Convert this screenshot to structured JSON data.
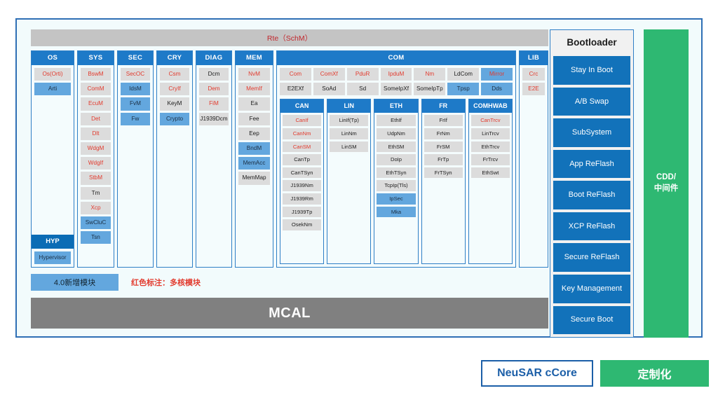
{
  "frame": {
    "rte_bar_label": "Rte（SchM）",
    "mcal_label": "MCAL"
  },
  "legend": {
    "new_module_label": "4.0新增模块",
    "red_note_label": "红色标注：多核模块"
  },
  "columns": [
    {
      "id": "os",
      "header": "OS",
      "modules": [
        {
          "label": "Os(Orti)",
          "style": "red"
        },
        {
          "label": "Arti",
          "style": "blue"
        }
      ],
      "sub_block": {
        "header": "HYP",
        "modules": [
          {
            "label": "Hypervisor",
            "style": "blue"
          }
        ]
      }
    },
    {
      "id": "sys",
      "header": "SYS",
      "modules": [
        {
          "label": "BswM",
          "style": "red"
        },
        {
          "label": "ComM",
          "style": "red"
        },
        {
          "label": "EcuM",
          "style": "red"
        },
        {
          "label": "Det",
          "style": "red"
        },
        {
          "label": "Dlt",
          "style": "red"
        },
        {
          "label": "WdgM",
          "style": "red"
        },
        {
          "label": "WdgIf",
          "style": "red"
        },
        {
          "label": "StbM",
          "style": "red"
        },
        {
          "label": "Tm",
          "style": "plain"
        },
        {
          "label": "Xcp",
          "style": "red"
        },
        {
          "label": "SwCluC",
          "style": "blue"
        },
        {
          "label": "Tsn",
          "style": "blue"
        }
      ]
    },
    {
      "id": "sec",
      "header": "SEC",
      "modules": [
        {
          "label": "SecOC",
          "style": "red"
        },
        {
          "label": "IdsM",
          "style": "blue"
        },
        {
          "label": "FvM",
          "style": "blue"
        },
        {
          "label": "Fw",
          "style": "blue"
        }
      ]
    },
    {
      "id": "cry",
      "header": "CRY",
      "modules": [
        {
          "label": "Csm",
          "style": "red"
        },
        {
          "label": "CryIf",
          "style": "red"
        },
        {
          "label": "KeyM",
          "style": "plain"
        },
        {
          "label": "Crypto",
          "style": "blue"
        }
      ]
    },
    {
      "id": "diag",
      "header": "DIAG",
      "modules": [
        {
          "label": "Dcm",
          "style": "plain"
        },
        {
          "label": "Dem",
          "style": "red"
        },
        {
          "label": "FiM",
          "style": "red"
        },
        {
          "label": "J1939Dcm",
          "style": "plain"
        }
      ]
    },
    {
      "id": "mem",
      "header": "MEM",
      "modules": [
        {
          "label": "NvM",
          "style": "red"
        },
        {
          "label": "MemIf",
          "style": "red"
        },
        {
          "label": "Ea",
          "style": "plain"
        },
        {
          "label": "Fee",
          "style": "plain"
        },
        {
          "label": "Eep",
          "style": "plain"
        },
        {
          "label": "BndM",
          "style": "blue"
        },
        {
          "label": "MemAcc",
          "style": "blue"
        },
        {
          "label": "MemMap",
          "style": "plain"
        }
      ]
    }
  ],
  "com": {
    "header": "COM",
    "row1": [
      {
        "label": "Com",
        "style": "red"
      },
      {
        "label": "ComXf",
        "style": "red"
      },
      {
        "label": "PduR",
        "style": "red"
      },
      {
        "label": "IpduM",
        "style": "red"
      },
      {
        "label": "Nm",
        "style": "red"
      },
      {
        "label": "LdCom",
        "style": "plain"
      },
      {
        "label": "Mirror",
        "style": "blue red"
      }
    ],
    "row2": [
      {
        "label": "E2EXf",
        "style": "plain"
      },
      {
        "label": "SoAd",
        "style": "plain"
      },
      {
        "label": "Sd",
        "style": "plain"
      },
      {
        "label": "SomeIpXf",
        "style": "plain"
      },
      {
        "label": "SomeIpTp",
        "style": "plain"
      },
      {
        "label": "Tpsp",
        "style": "blue"
      },
      {
        "label": "Dds",
        "style": "blue"
      }
    ],
    "subcolumns": [
      {
        "id": "can",
        "header": "CAN",
        "modules": [
          {
            "label": "CanIf",
            "style": "red"
          },
          {
            "label": "CanNm",
            "style": "red"
          },
          {
            "label": "CanSM",
            "style": "red"
          },
          {
            "label": "CanTp",
            "style": "plain"
          },
          {
            "label": "CanTSyn",
            "style": "plain"
          },
          {
            "label": "J1939Nm",
            "style": "plain"
          },
          {
            "label": "J1939Rm",
            "style": "plain"
          },
          {
            "label": "J1939Tp",
            "style": "plain"
          },
          {
            "label": "OsekNm",
            "style": "plain"
          }
        ]
      },
      {
        "id": "lin",
        "header": "LIN",
        "modules": [
          {
            "label": "LinIf(Tp)",
            "style": "plain"
          },
          {
            "label": "LinNm",
            "style": "plain"
          },
          {
            "label": "LinSM",
            "style": "plain"
          }
        ]
      },
      {
        "id": "eth",
        "header": "ETH",
        "modules": [
          {
            "label": "EthIf",
            "style": "plain"
          },
          {
            "label": "UdpNm",
            "style": "plain"
          },
          {
            "label": "EthSM",
            "style": "plain"
          },
          {
            "label": "DoIp",
            "style": "plain"
          },
          {
            "label": "EthTSyn",
            "style": "plain"
          },
          {
            "label": "TcpIp(Tls)",
            "style": "plain"
          },
          {
            "label": "IpSec",
            "style": "blue"
          },
          {
            "label": "Mka",
            "style": "blue"
          }
        ]
      },
      {
        "id": "fr",
        "header": "FR",
        "modules": [
          {
            "label": "FrIf",
            "style": "plain"
          },
          {
            "label": "FrNm",
            "style": "plain"
          },
          {
            "label": "FrSM",
            "style": "plain"
          },
          {
            "label": "FrTp",
            "style": "plain"
          },
          {
            "label": "FrTSyn",
            "style": "plain"
          }
        ]
      },
      {
        "id": "comhwab",
        "header": "COMHWAB",
        "modules": [
          {
            "label": "CanTrcv",
            "style": "red"
          },
          {
            "label": "LinTrcv",
            "style": "plain"
          },
          {
            "label": "EthTrcv",
            "style": "plain"
          },
          {
            "label": "FrTrcv",
            "style": "plain"
          },
          {
            "label": "EthSwt",
            "style": "plain"
          }
        ]
      }
    ]
  },
  "lib": {
    "header": "LIB",
    "modules": [
      {
        "label": "Crc",
        "style": "red"
      },
      {
        "label": "E2E",
        "style": "red"
      }
    ]
  },
  "bootloader": {
    "title": "Bootloader",
    "items": [
      "Stay In Boot",
      "A/B Swap",
      "SubSystem",
      "App ReFlash",
      "Boot ReFlash",
      "XCP ReFlash",
      "Secure ReFlash",
      "Key Management",
      "Secure Boot"
    ]
  },
  "cdd": {
    "label": "CDD/\n中间件"
  },
  "footer": {
    "ccore_label": "NeuSAR cCore",
    "custom_label": "定制化"
  },
  "colors": {
    "header_blue": "#1e7ac8",
    "module_blue": "#63a7de",
    "module_gray": "#dcdcdc",
    "red_text": "#e23b2e",
    "mcal_gray": "#808080",
    "green": "#2eb872",
    "boot_blue": "#1272ba",
    "frame_border": "#2f6fb5"
  }
}
